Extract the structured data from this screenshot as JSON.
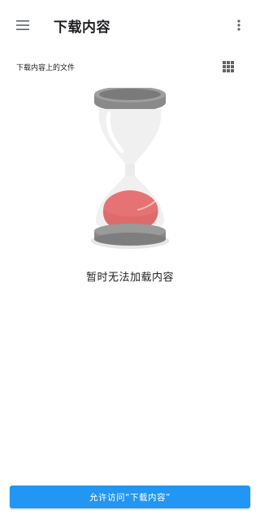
{
  "header": {
    "title": "下载内容",
    "menu_icon": "hamburger-menu-icon",
    "more_icon": "more-vert-icon"
  },
  "section": {
    "title": "下载内容上的文件",
    "view_icon": "grid-view-icon"
  },
  "empty_state": {
    "illustration": "hourglass-icon",
    "message": "暂时无法加载内容"
  },
  "footer": {
    "allow_button_label": "允许访问“下载内容”"
  },
  "colors": {
    "accent": "#2196f3",
    "sand": "#e57373",
    "frame": "#8a8a8a"
  }
}
